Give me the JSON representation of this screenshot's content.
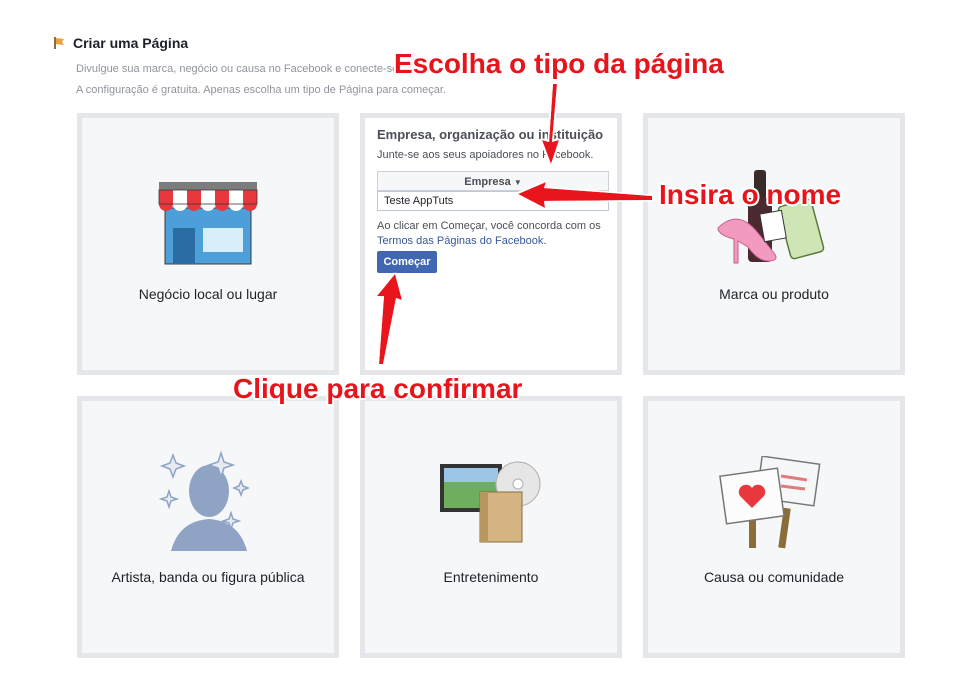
{
  "header": {
    "title": "Criar uma Página",
    "description_1": "Divulgue sua marca, negócio ou causa no Facebook e conecte-se",
    "description_2": "A configuração é gratuita. Apenas escolha um tipo de Página para começar."
  },
  "tiles": [
    {
      "label": "Negócio local ou lugar",
      "icon": "storefront-icon"
    },
    {
      "label": "Empresa, organização ou instituição",
      "icon": ""
    },
    {
      "label": "Marca ou produto",
      "icon": "brand-products-icon"
    },
    {
      "label": "Artista, banda ou figura pública",
      "icon": "public-figure-icon"
    },
    {
      "label": "Entretenimento",
      "icon": "entertainment-icon"
    },
    {
      "label": "Causa ou comunidade",
      "icon": "cause-signs-icon"
    }
  ],
  "form": {
    "title": "Empresa, organização ou instituição",
    "subtitle": "Junte-se aos seus apoiadores no Facebook.",
    "category_selected": "Empresa",
    "name_value": "Teste AppTuts",
    "terms_prefix": "Ao clicar em Começar, você concorda com os",
    "terms_link": "Termos das Páginas do Facebook",
    "terms_suffix": ".",
    "submit_label": "Começar"
  },
  "annotations": {
    "choose_type": "Escolha o tipo da página",
    "insert_name": "Insira o nome",
    "click_confirm": "Clique para confirmar",
    "color": "#e8141b"
  }
}
